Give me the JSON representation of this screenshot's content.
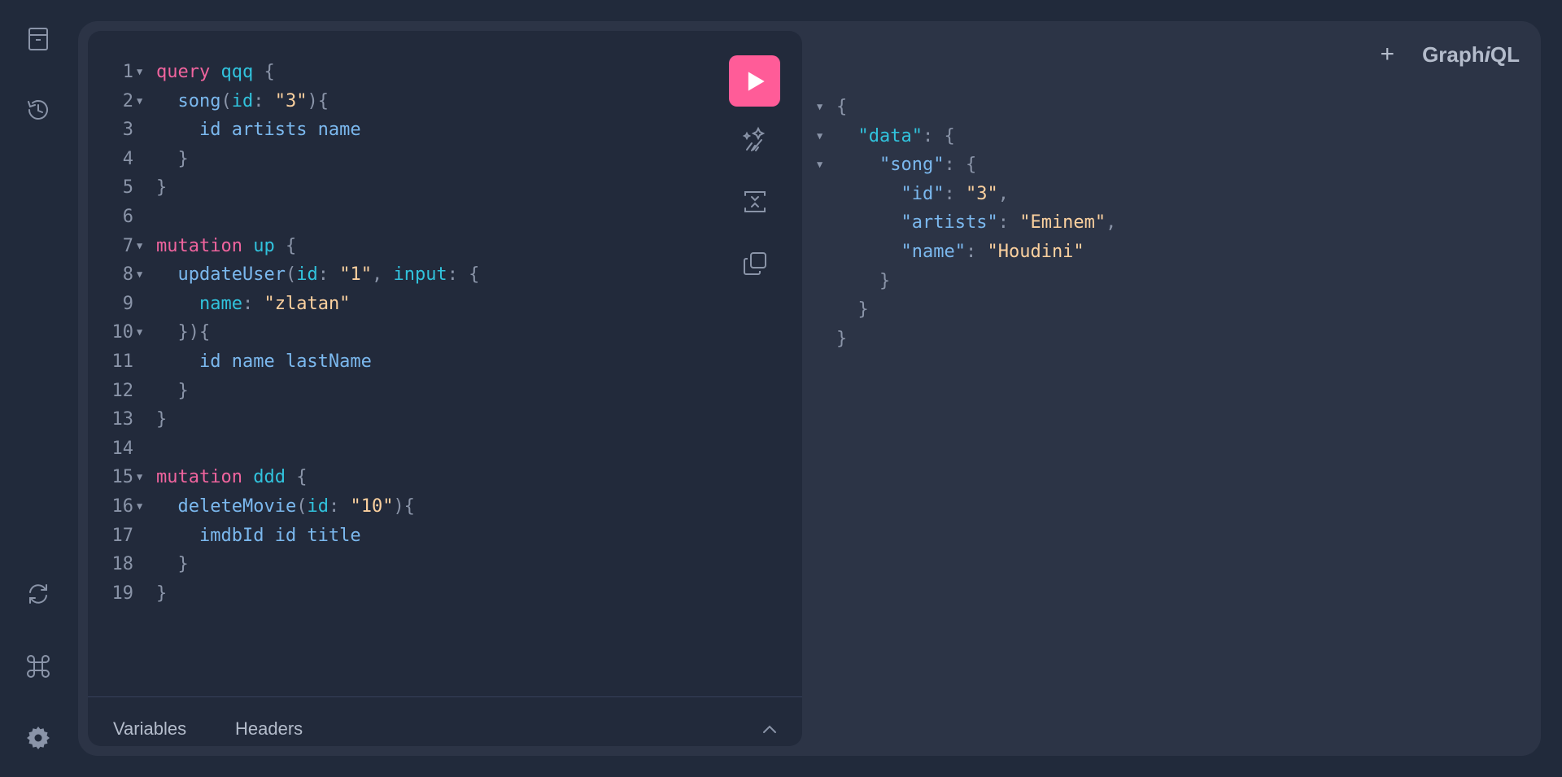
{
  "app": {
    "brand": {
      "pre": "Graph",
      "italic": "i",
      "post": "QL"
    },
    "add_tab_label": "+"
  },
  "sidebar": {
    "top_icons": [
      "docs-icon",
      "history-icon"
    ],
    "bottom_icons": [
      "refetch-schema-icon",
      "shortcuts-icon",
      "settings-icon"
    ]
  },
  "editor": {
    "lines": [
      {
        "n": "1",
        "fold": true,
        "parts": [
          [
            "kw",
            "query"
          ],
          [
            "sp",
            " "
          ],
          [
            "def",
            "qqq"
          ],
          [
            "sp",
            " "
          ],
          [
            "pun",
            "{"
          ]
        ]
      },
      {
        "n": "2",
        "fold": true,
        "parts": [
          [
            "sp",
            "  "
          ],
          [
            "fn",
            "song"
          ],
          [
            "pun",
            "("
          ],
          [
            "arg",
            "id"
          ],
          [
            "pun",
            ": "
          ],
          [
            "str",
            "\"3\""
          ],
          [
            "pun",
            "){"
          ]
        ]
      },
      {
        "n": "3",
        "fold": false,
        "parts": [
          [
            "sp",
            "    "
          ],
          [
            "fld",
            "id artists name"
          ]
        ]
      },
      {
        "n": "4",
        "fold": false,
        "parts": [
          [
            "sp",
            "  "
          ],
          [
            "pun",
            "}"
          ]
        ]
      },
      {
        "n": "5",
        "fold": false,
        "parts": [
          [
            "pun",
            "}"
          ]
        ]
      },
      {
        "n": "6",
        "fold": false,
        "parts": []
      },
      {
        "n": "7",
        "fold": true,
        "parts": [
          [
            "kw",
            "mutation"
          ],
          [
            "sp",
            " "
          ],
          [
            "def",
            "up"
          ],
          [
            "sp",
            " "
          ],
          [
            "pun",
            "{"
          ]
        ]
      },
      {
        "n": "8",
        "fold": true,
        "parts": [
          [
            "sp",
            "  "
          ],
          [
            "fn",
            "updateUser"
          ],
          [
            "pun",
            "("
          ],
          [
            "arg",
            "id"
          ],
          [
            "pun",
            ": "
          ],
          [
            "str",
            "\"1\""
          ],
          [
            "pun",
            ", "
          ],
          [
            "arg",
            "input"
          ],
          [
            "pun",
            ": {"
          ]
        ]
      },
      {
        "n": "9",
        "fold": false,
        "parts": [
          [
            "sp",
            "    "
          ],
          [
            "arg",
            "name"
          ],
          [
            "pun",
            ": "
          ],
          [
            "str",
            "\"zlatan\""
          ]
        ]
      },
      {
        "n": "10",
        "fold": true,
        "parts": [
          [
            "sp",
            "  "
          ],
          [
            "pun",
            "}){"
          ]
        ]
      },
      {
        "n": "11",
        "fold": false,
        "parts": [
          [
            "sp",
            "    "
          ],
          [
            "fld",
            "id name lastName"
          ]
        ]
      },
      {
        "n": "12",
        "fold": false,
        "parts": [
          [
            "sp",
            "  "
          ],
          [
            "pun",
            "}"
          ]
        ]
      },
      {
        "n": "13",
        "fold": false,
        "parts": [
          [
            "pun",
            "}"
          ]
        ]
      },
      {
        "n": "14",
        "fold": false,
        "parts": []
      },
      {
        "n": "15",
        "fold": true,
        "parts": [
          [
            "kw",
            "mutation"
          ],
          [
            "sp",
            " "
          ],
          [
            "def",
            "ddd"
          ],
          [
            "sp",
            " "
          ],
          [
            "pun",
            "{"
          ]
        ]
      },
      {
        "n": "16",
        "fold": true,
        "parts": [
          [
            "sp",
            "  "
          ],
          [
            "fn",
            "deleteMovie"
          ],
          [
            "pun",
            "("
          ],
          [
            "arg",
            "id"
          ],
          [
            "pun",
            ": "
          ],
          [
            "str",
            "\"10\""
          ],
          [
            "pun",
            "){"
          ]
        ]
      },
      {
        "n": "17",
        "fold": false,
        "parts": [
          [
            "sp",
            "    "
          ],
          [
            "fld",
            "imdbId id title"
          ]
        ]
      },
      {
        "n": "18",
        "fold": false,
        "parts": [
          [
            "sp",
            "  "
          ],
          [
            "pun",
            "}"
          ]
        ]
      },
      {
        "n": "19",
        "fold": false,
        "parts": [
          [
            "pun",
            "}"
          ]
        ]
      }
    ],
    "tools": [
      "prettify-icon",
      "merge-fragments-icon",
      "copy-icon"
    ],
    "run_icon": "play-icon"
  },
  "bottom_tabs": {
    "variables": "Variables",
    "headers": "Headers"
  },
  "result": {
    "lines": [
      {
        "fold": true,
        "parts": [
          [
            "pun",
            "{"
          ]
        ]
      },
      {
        "fold": true,
        "parts": [
          [
            "sp",
            "  "
          ],
          [
            "keyd",
            "\"data\""
          ],
          [
            "pun",
            ": {"
          ]
        ]
      },
      {
        "fold": true,
        "parts": [
          [
            "sp",
            "    "
          ],
          [
            "key",
            "\"song\""
          ],
          [
            "pun",
            ": {"
          ]
        ]
      },
      {
        "fold": false,
        "parts": [
          [
            "sp",
            "      "
          ],
          [
            "key",
            "\"id\""
          ],
          [
            "pun",
            ": "
          ],
          [
            "str",
            "\"3\""
          ],
          [
            "pun",
            ","
          ]
        ]
      },
      {
        "fold": false,
        "parts": [
          [
            "sp",
            "      "
          ],
          [
            "key",
            "\"artists\""
          ],
          [
            "pun",
            ": "
          ],
          [
            "str",
            "\"Eminem\""
          ],
          [
            "pun",
            ","
          ]
        ]
      },
      {
        "fold": false,
        "parts": [
          [
            "sp",
            "      "
          ],
          [
            "key",
            "\"name\""
          ],
          [
            "pun",
            ": "
          ],
          [
            "str",
            "\"Houdini\""
          ]
        ]
      },
      {
        "fold": false,
        "parts": [
          [
            "sp",
            "    "
          ],
          [
            "pun",
            "}"
          ]
        ]
      },
      {
        "fold": false,
        "parts": [
          [
            "sp",
            "  "
          ],
          [
            "pun",
            "}"
          ]
        ]
      },
      {
        "fold": false,
        "parts": [
          [
            "pun",
            "}"
          ]
        ]
      }
    ]
  },
  "colors": {
    "accent": "#ff5c98",
    "keyword": "#f0649e",
    "definition": "#31c3dd",
    "field": "#7bb8ee",
    "string": "#fcd19f",
    "punctuation": "#8a94a8"
  }
}
